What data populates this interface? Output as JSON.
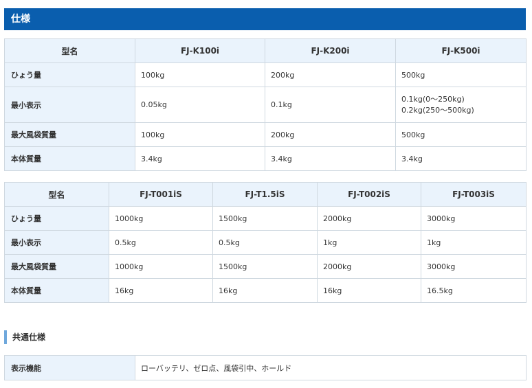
{
  "section_title": "仕様",
  "table1": {
    "headers": [
      "型名",
      "FJ-K100i",
      "FJ-K200i",
      "FJ-K500i"
    ],
    "rows": [
      {
        "label": "ひょう量",
        "cells": [
          [
            "100kg"
          ],
          [
            "200kg"
          ],
          [
            "500kg"
          ]
        ]
      },
      {
        "label": "最小表示",
        "cells": [
          [
            "0.05kg"
          ],
          [
            "0.1kg"
          ],
          [
            "0.1kg(0〜250kg)",
            "0.2kg(250〜500kg)"
          ]
        ]
      },
      {
        "label": "最大風袋質量",
        "cells": [
          [
            "100kg"
          ],
          [
            "200kg"
          ],
          [
            "500kg"
          ]
        ]
      },
      {
        "label": "本体質量",
        "cells": [
          [
            "3.4kg"
          ],
          [
            "3.4kg"
          ],
          [
            "3.4kg"
          ]
        ]
      }
    ]
  },
  "table2": {
    "headers": [
      "型名",
      "FJ-T001iS",
      "FJ-T1.5iS",
      "FJ-T002iS",
      "FJ-T003iS"
    ],
    "rows": [
      {
        "label": "ひょう量",
        "cells": [
          "1000kg",
          "1500kg",
          "2000kg",
          "3000kg"
        ]
      },
      {
        "label": "最小表示",
        "cells": [
          "0.5kg",
          "0.5kg",
          "1kg",
          "1kg"
        ]
      },
      {
        "label": "最大風袋質量",
        "cells": [
          "1000kg",
          "1500kg",
          "2000kg",
          "3000kg"
        ]
      },
      {
        "label": "本体質量",
        "cells": [
          "16kg",
          "16kg",
          "16kg",
          "16.5kg"
        ]
      }
    ]
  },
  "common_spec": {
    "heading": "共通仕様",
    "rows": [
      {
        "label": "表示機能",
        "value": "ローバッテリ、ゼロ点、風袋引中、ホールド"
      }
    ]
  },
  "colors": {
    "section_bar": "#0a5eae",
    "header_bg": "#eaf3fc",
    "border": "#cfd8e0",
    "subheading_accent": "#6fa8dc"
  }
}
